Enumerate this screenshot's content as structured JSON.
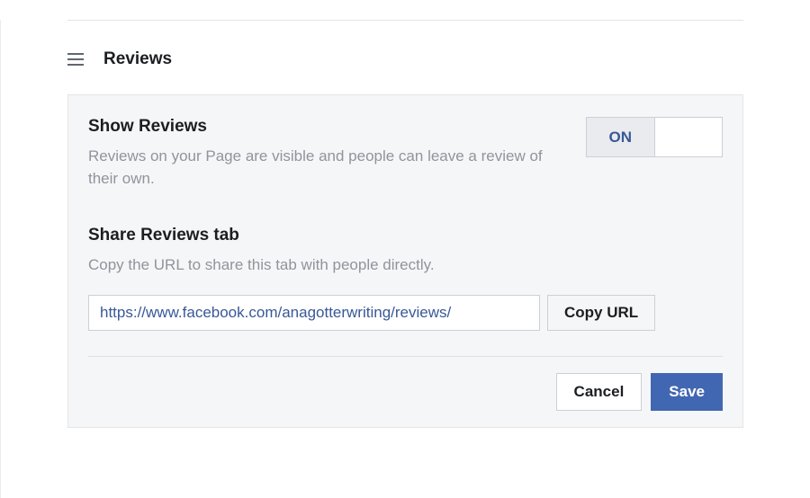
{
  "section": {
    "title": "Reviews"
  },
  "showReviews": {
    "heading": "Show Reviews",
    "description": "Reviews on your Page are visible and people can leave a review of their own.",
    "toggleLabel": "ON"
  },
  "shareTab": {
    "heading": "Share Reviews tab",
    "description": "Copy the URL to share this tab with people directly.",
    "url": "https://www.facebook.com/anagotterwriting/reviews/",
    "copyLabel": "Copy URL"
  },
  "actions": {
    "cancel": "Cancel",
    "save": "Save"
  }
}
